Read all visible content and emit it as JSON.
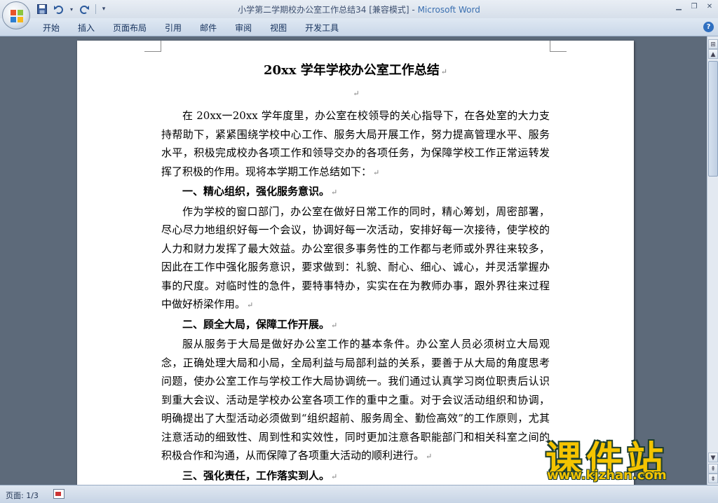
{
  "window": {
    "title_doc": "小学第二学期校办公室工作总结34 [兼容模式]",
    "title_sep": " - ",
    "title_app": "Microsoft Word"
  },
  "ribbon": {
    "tabs": [
      "开始",
      "插入",
      "页面布局",
      "引用",
      "邮件",
      "审阅",
      "视图",
      "开发工具"
    ]
  },
  "document": {
    "title": "20xx 学年学校办公室工作总结",
    "paragraph_mark": "↵",
    "intro": "在 20xx一20xx 学年度里，办公室在校领导的关心指导下，在各处室的大力支持帮助下，紧紧围绕学校中心工作、服务大局开展工作，努力提高管理水平、服务水平，积极完成校办各项工作和领导交办的各项任务，为保障学校工作正常运转发挥了积极的作用。现将本学期工作总结如下：",
    "section1_heading": "一、精心组织，强化服务意识。",
    "section1_body": "作为学校的窗口部门，办公室在做好日常工作的同时，精心筹划，周密部署，尽心尽力地组织好每一个会议，协调好每一次活动，安排好每一次接待，使学校的人力和财力发挥了最大效益。办公室很多事务性的工作都与老师或外界往来较多，因此在工作中强化服务意识，要求做到：礼貌、耐心、细心、诚心，并灵活掌握办事的尺度。对临时性的急件，要特事特办，实实在在为教师办事，跟外界往来过程中做好桥梁作用。",
    "section2_heading": "二、顾全大局，保障工作开展。",
    "section2_body": "服从服务于大局是做好办公室工作的基本条件。办公室人员必须树立大局观念，正确处理大局和小局，全局利益与局部利益的关系，要善于从大局的角度思考问题，使办公室工作与学校工作大局协调统一。我们通过认真学习岗位职责后认识到重大会议、活动是学校办公室各项工作的重中之重。对于会议活动组织和协调，明确提出了大型活动必须做到“组织超前、服务周全、勤俭高效”的工作原则，尤其注意活动的细致性、周到性和实效性，同时更加注意各职能部门和相关科室之间的积极合作和沟通，从而保障了各项重大活动的顺利进行。",
    "section3_heading": "三、强化责任，工作落实到人。"
  },
  "statusbar": {
    "page_info": "页面: 1/3"
  },
  "watermark": {
    "text": "课件站",
    "url": "www.kjzhan.com"
  },
  "icons": {
    "save": "save-icon",
    "undo": "undo-icon",
    "redo": "redo-icon",
    "help": "help-icon"
  },
  "colors": {
    "workspace": "#5d6a7a",
    "ribbon": "#c9d7e8",
    "title_app": "#3a6fb0",
    "watermark": "#f4c400"
  }
}
